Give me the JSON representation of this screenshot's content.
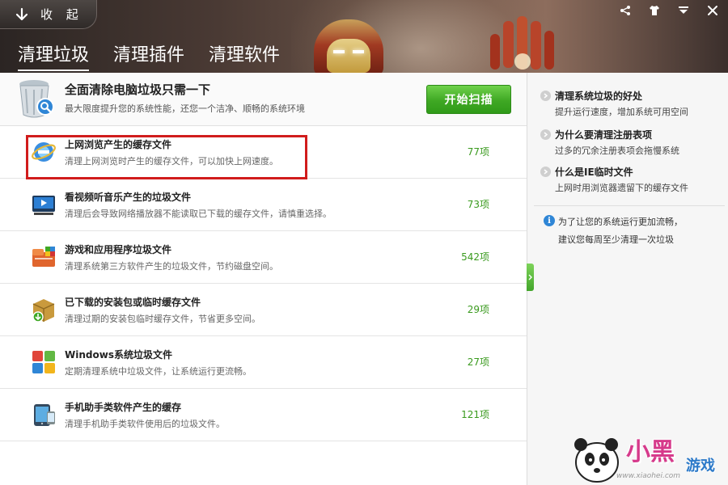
{
  "header": {
    "collapse_label": "收 起",
    "tabs": [
      {
        "label": "清理垃圾",
        "active": true
      },
      {
        "label": "清理插件",
        "active": false
      },
      {
        "label": "清理软件",
        "active": false
      }
    ],
    "window_controls": [
      "share-icon",
      "shirt-icon",
      "minimize-icon",
      "close-icon"
    ]
  },
  "summary": {
    "title": "全面清除电脑垃圾只需一下",
    "description": "最大限度提升您的系统性能，还您一个洁净、顺畅的系统环境",
    "scan_button": "开始扫描"
  },
  "items": [
    {
      "title": "上网浏览产生的缓存文件",
      "description": "清理上网浏览时产生的缓存文件，可以加快上网速度。",
      "count": "77项",
      "icon": "ie-browser-icon"
    },
    {
      "title": "看视频听音乐产生的垃圾文件",
      "description": "清理后会导致网络播放器不能读取已下载的缓存文件，请慎重选择。",
      "count": "73项",
      "icon": "video-player-icon"
    },
    {
      "title": "游戏和应用程序垃圾文件",
      "description": "清理系统第三方软件产生的垃圾文件，节约磁盘空间。",
      "count": "542项",
      "icon": "game-app-icon"
    },
    {
      "title": "已下载的安装包或临时缓存文件",
      "description": "清理过期的安装包临时缓存文件，节省更多空间。",
      "count": "29项",
      "icon": "download-package-icon"
    },
    {
      "title": "Windows系统垃圾文件",
      "description": "定期清理系统中垃圾文件，让系统运行更流畅。",
      "count": "27项",
      "icon": "windows-icon"
    },
    {
      "title": "手机助手类软件产生的缓存",
      "description": "清理手机助手类软件使用后的垃圾文件。",
      "count": "121项",
      "icon": "phone-assistant-icon"
    }
  ],
  "side": {
    "tips": [
      {
        "title": "清理系统垃圾的好处",
        "description": "提升运行速度，增加系统可用空间"
      },
      {
        "title": "为什么要清理注册表项",
        "description": "过多的冗余注册表项会拖慢系统"
      },
      {
        "title": "什么是IE临时文件",
        "description": "上网时用浏览器遗留下的缓存文件"
      }
    ],
    "info_line1": "为了让您的系统运行更加流畅，",
    "info_line2": "建议您每周至少清理一次垃圾"
  },
  "watermark": {
    "logo": "小黑",
    "logo2": "游戏",
    "url": "www.xiaohei.com"
  },
  "colors": {
    "accent_green": "#3fa824",
    "count_green": "#3a9a1e",
    "highlight_red": "#d11c1c",
    "info_blue": "#2f86d6"
  }
}
